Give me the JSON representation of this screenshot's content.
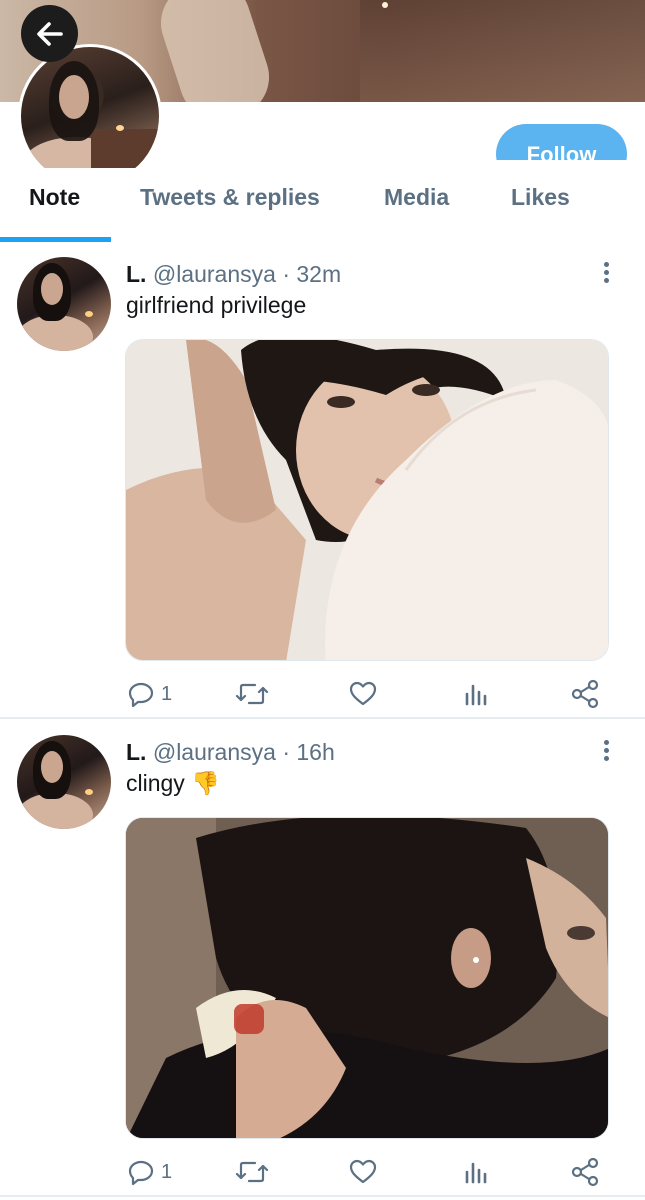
{
  "header": {
    "follow_label": "Follow"
  },
  "tabs": [
    {
      "label": "Note",
      "active": true
    },
    {
      "label": "Tweets & replies",
      "active": false
    },
    {
      "label": "Media",
      "active": false
    },
    {
      "label": "Likes",
      "active": false
    }
  ],
  "tweets": [
    {
      "name": "L.",
      "handle": "@lauransya",
      "time": "· 32m",
      "text": "girlfriend privilege",
      "emoji": "",
      "reply_count": "1"
    },
    {
      "name": "L.",
      "handle": "@lauransya",
      "time": "· 16h",
      "text": "clingy",
      "emoji": "👎",
      "reply_count": "1"
    }
  ],
  "icons": {
    "back": "arrow-left-icon",
    "more": "more-vertical-icon",
    "reply": "reply-icon",
    "retweet": "retweet-icon",
    "like": "heart-icon",
    "analytics": "analytics-icon",
    "share": "share-icon"
  },
  "colors": {
    "accent": "#1da1f2",
    "follow_bg": "#5bb4f0",
    "secondary_text": "#5b7083"
  }
}
